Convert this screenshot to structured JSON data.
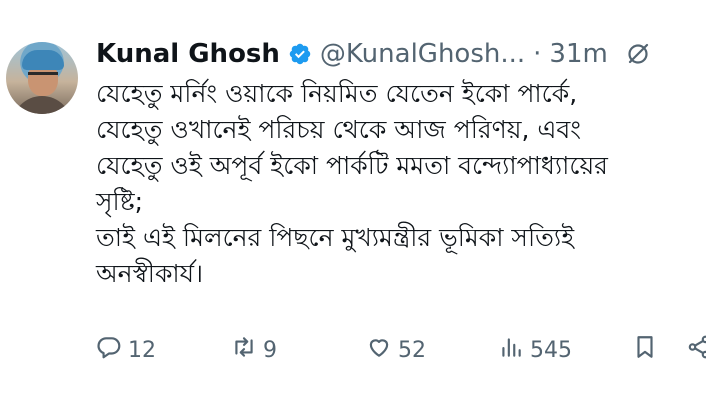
{
  "tweet": {
    "author_name": "Kunal Ghosh",
    "handle": "@KunalGhosh...",
    "separator": "·",
    "time": "31m",
    "lines": [
      "যেহেতু মর্নিং ওয়াকে নিয়মিত যেতেন ইকো পার্কে,",
      "যেহেতু ওখানেই পরিচয় থেকে আজ পরিণয়, এবং",
      "যেহেতু ওই অপূর্ব ইকো পার্কটি মমতা বন্দ্যোপাধ্যায়ের",
      "সৃষ্টি;",
      "তাই এই মিলনের পিছনে মুখ্যমন্ত্রীর ভূমিকা সত্যিই",
      "অনস্বীকার্য।"
    ]
  },
  "actions": {
    "replies": "12",
    "reposts": "9",
    "likes": "52",
    "views": "545"
  },
  "icons": {
    "verified": "verified-badge-icon",
    "grok": "grok-icon",
    "reply": "reply-icon",
    "repost": "repost-icon",
    "like": "heart-icon",
    "views": "views-icon",
    "bookmark": "bookmark-icon",
    "share": "share-icon"
  },
  "colors": {
    "text": "#0f1419",
    "secondary": "#536471",
    "verified": "#1d9bf0"
  }
}
